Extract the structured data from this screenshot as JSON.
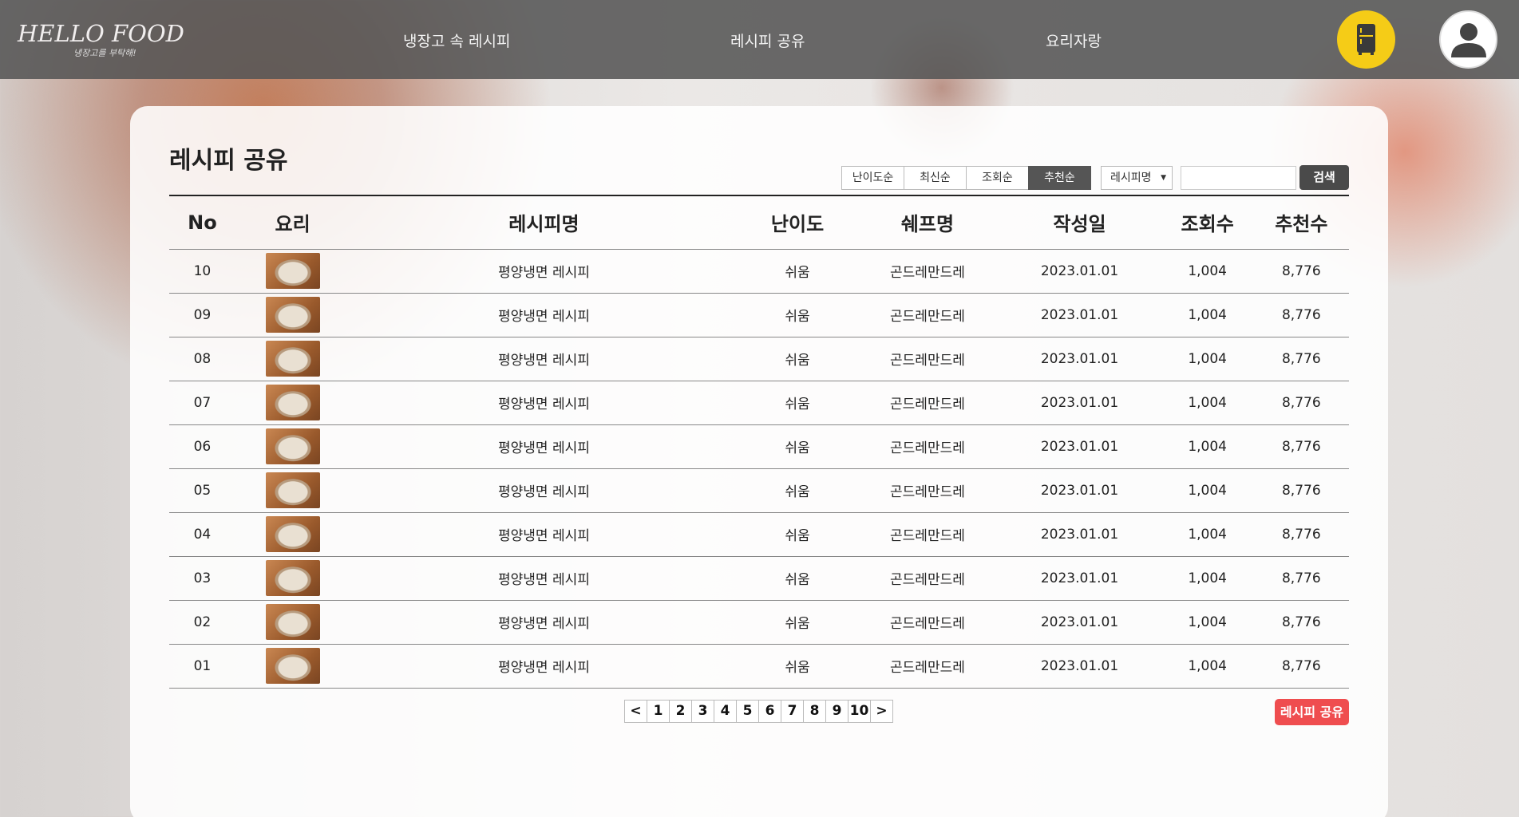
{
  "header": {
    "logo_main": "HELLO FOOD",
    "logo_sub": "냉장고를 부탁해!",
    "nav": [
      "냉장고 속 레시피",
      "레시피 공유",
      "요리자랑"
    ]
  },
  "page": {
    "title": "레시피 공유",
    "sort_options": [
      "난이도순",
      "최신순",
      "조회순",
      "추천순"
    ],
    "active_sort": "추천순",
    "search_field_selected": "레시피명",
    "search_value": "",
    "search_button": "검색",
    "share_button": "레시피 공유"
  },
  "table": {
    "headers": [
      "No",
      "요리",
      "레시피명",
      "난이도",
      "쉐프명",
      "작성일",
      "조회수",
      "추천수"
    ],
    "rows": [
      {
        "no": "10",
        "name": "평양냉면 레시피",
        "difficulty": "쉬움",
        "chef": "곤드레만드레",
        "date": "2023.01.01",
        "views": "1,004",
        "likes": "8,776"
      },
      {
        "no": "09",
        "name": "평양냉면 레시피",
        "difficulty": "쉬움",
        "chef": "곤드레만드레",
        "date": "2023.01.01",
        "views": "1,004",
        "likes": "8,776"
      },
      {
        "no": "08",
        "name": "평양냉면 레시피",
        "difficulty": "쉬움",
        "chef": "곤드레만드레",
        "date": "2023.01.01",
        "views": "1,004",
        "likes": "8,776"
      },
      {
        "no": "07",
        "name": "평양냉면 레시피",
        "difficulty": "쉬움",
        "chef": "곤드레만드레",
        "date": "2023.01.01",
        "views": "1,004",
        "likes": "8,776"
      },
      {
        "no": "06",
        "name": "평양냉면 레시피",
        "difficulty": "쉬움",
        "chef": "곤드레만드레",
        "date": "2023.01.01",
        "views": "1,004",
        "likes": "8,776"
      },
      {
        "no": "05",
        "name": "평양냉면 레시피",
        "difficulty": "쉬움",
        "chef": "곤드레만드레",
        "date": "2023.01.01",
        "views": "1,004",
        "likes": "8,776"
      },
      {
        "no": "04",
        "name": "평양냉면 레시피",
        "difficulty": "쉬움",
        "chef": "곤드레만드레",
        "date": "2023.01.01",
        "views": "1,004",
        "likes": "8,776"
      },
      {
        "no": "03",
        "name": "평양냉면 레시피",
        "difficulty": "쉬움",
        "chef": "곤드레만드레",
        "date": "2023.01.01",
        "views": "1,004",
        "likes": "8,776"
      },
      {
        "no": "02",
        "name": "평양냉면 레시피",
        "difficulty": "쉬움",
        "chef": "곤드레만드레",
        "date": "2023.01.01",
        "views": "1,004",
        "likes": "8,776"
      },
      {
        "no": "01",
        "name": "평양냉면 레시피",
        "difficulty": "쉬움",
        "chef": "곤드레만드레",
        "date": "2023.01.01",
        "views": "1,004",
        "likes": "8,776"
      }
    ]
  },
  "pagination": {
    "prev": "<",
    "pages": [
      "1",
      "2",
      "3",
      "4",
      "5",
      "6",
      "7",
      "8",
      "9",
      "10"
    ],
    "next": ">"
  },
  "colors": {
    "accent_yellow": "#f5cc17",
    "share_red": "#ef4d4f",
    "header_bg": "#555555"
  },
  "icons": [
    "refrigerator-icon",
    "user-icon",
    "dropdown-arrow-icon"
  ]
}
